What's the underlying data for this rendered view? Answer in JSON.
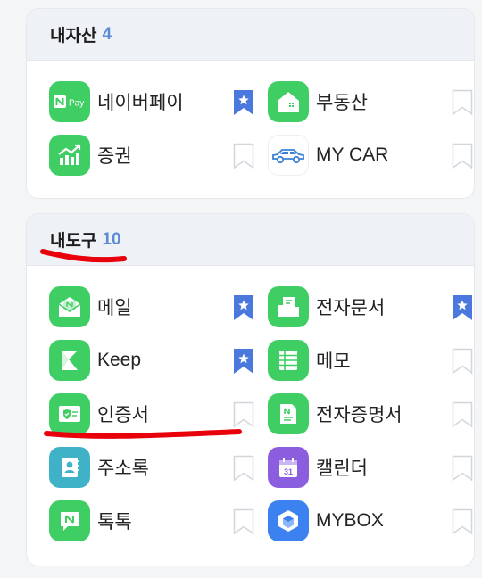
{
  "assets": {
    "title": "내자산",
    "count": "4",
    "items": [
      {
        "label": "네이버페이",
        "icon": "naver-pay-icon",
        "icon_text": "N Pay",
        "bookmarked": true
      },
      {
        "label": "부동산",
        "icon": "house-icon",
        "bookmarked": false
      },
      {
        "label": "증권",
        "icon": "stock-chart-icon",
        "bookmarked": false
      },
      {
        "label": "MY CAR",
        "icon": "car-icon",
        "bookmarked": false
      }
    ]
  },
  "tools": {
    "title": "내도구",
    "count": "10",
    "items": [
      {
        "label": "메일",
        "icon": "mail-icon",
        "bookmarked": true
      },
      {
        "label": "전자문서",
        "icon": "document-folder-icon",
        "bookmarked": true
      },
      {
        "label": "Keep",
        "icon": "keep-icon",
        "bookmarked": true
      },
      {
        "label": "메모",
        "icon": "memo-icon",
        "bookmarked": false
      },
      {
        "label": "인증서",
        "icon": "certificate-icon",
        "bookmarked": false
      },
      {
        "label": "전자증명서",
        "icon": "e-certificate-icon",
        "icon_text": "N",
        "bookmarked": false
      },
      {
        "label": "주소록",
        "icon": "contacts-icon",
        "bookmarked": false
      },
      {
        "label": "캘린더",
        "icon": "calendar-icon",
        "icon_text": "31",
        "bookmarked": false
      },
      {
        "label": "톡톡",
        "icon": "talktalk-icon",
        "icon_text": "N",
        "bookmarked": false
      },
      {
        "label": "MYBOX",
        "icon": "mybox-icon",
        "bookmarked": false
      }
    ]
  },
  "colors": {
    "green": "#3fce63",
    "bookmark_active": "#4a78dd",
    "bookmark_inactive": "#d3d6dc",
    "count": "#5c8bd6",
    "annotation": "#e8000b"
  }
}
